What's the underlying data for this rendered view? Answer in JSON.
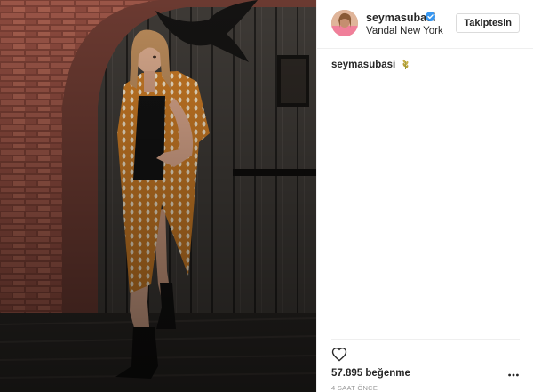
{
  "profile": {
    "username": "seymasubasi",
    "location": "Vandal New York",
    "verified": true,
    "follow_label": "Takiptesin"
  },
  "caption": {
    "username": "seymasubasi",
    "emoji": "wheat-icon"
  },
  "stats": {
    "likes_label": "57.895 beğenme",
    "timestamp": "4 SAAT ÖNCE"
  },
  "icons": {
    "like": "heart-icon",
    "more": "more-options-icon",
    "verified": "verified-badge-icon"
  },
  "colors": {
    "verified_blue": "#3897f0",
    "border": "#efefef",
    "text": "#262626",
    "muted": "#999999"
  }
}
